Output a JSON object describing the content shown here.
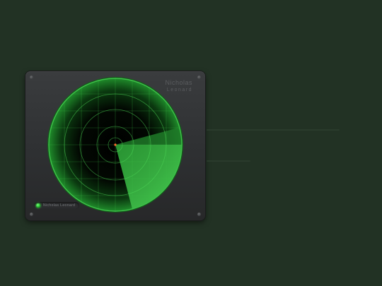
{
  "device": {
    "owner_name": "Nicholas",
    "owner_subtitle": "Leonard"
  },
  "radar": {
    "rings": 4,
    "grid": true,
    "sweep_colors": {
      "screen": "#000000",
      "rim": "#2fa83a",
      "sweep": "#3cc44a",
      "center": "#ff6a2a"
    }
  },
  "status": {
    "label": "Nicholas Leonard",
    "indicator_color": "#3cff48"
  }
}
